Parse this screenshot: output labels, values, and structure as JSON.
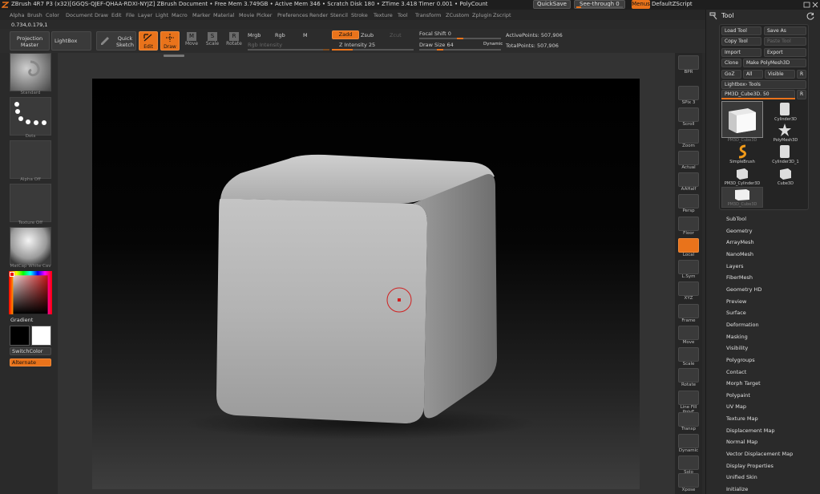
{
  "titlebar": {
    "title": "ZBrush 4R7 P3 (x32)[GGQS-QJEF-QHAA-RDXI-NYJZ]    ZBrush Document       • Free Mem 3.749GB • Active Mem 346 • Scratch Disk 180 •  ZTime 3.418  Timer 0.001 • PolyCount",
    "quicksave": "QuickSave",
    "see_through": "See-through  0",
    "see_through_value": 0,
    "menus": "Menus",
    "default_script": "DefaultZScript"
  },
  "menubar": {
    "items": [
      "Alpha",
      "Brush",
      "Color",
      "Document",
      "Draw",
      "Edit",
      "File",
      "Layer",
      "Light",
      "Macro",
      "Marker",
      "Material",
      "Movie",
      "Picker",
      "Preferences",
      "Render",
      "Stencil",
      "Stroke",
      "Texture",
      "Tool",
      "Transform",
      "ZCustom",
      "Zplugin",
      "Zscript"
    ]
  },
  "coords": "0.734,0.179,1",
  "toolbar": {
    "projection_master": "Projection Master",
    "lightbox": "LightBox",
    "quick_sketch": "Quick Sketch",
    "edit": "Edit",
    "draw": "Draw",
    "move": "Move",
    "scale": "Scale",
    "rotate": "Rotate",
    "mrgb": "Mrgb",
    "rgb": "Rgb",
    "m": "M",
    "rgb_intensity": "Rgb Intensity",
    "zadd": "Zadd",
    "zsub": "Zsub",
    "zcut": "Zcut",
    "z_intensity": "Z Intensity 25",
    "z_intensity_value": 25,
    "focal_shift": "Focal Shift 0",
    "draw_size": "Draw Size 64",
    "dynamic": "Dynamic",
    "active_points": "ActivePoints: 507,906",
    "total_points": "TotalPoints: 507,906"
  },
  "leftshelf": {
    "brush_caption": "Standard",
    "stroke_caption": "Dots",
    "alpha_caption": "Alpha Off",
    "texture_caption": "Texture Off",
    "material_caption": "MatCap White Cav",
    "gradient": "Gradient",
    "switch_color": "SwitchColor",
    "alternate": "Alternate"
  },
  "rightshelf": {
    "buttons": [
      "BPR",
      "SPix 3",
      "Scroll",
      "Zoom",
      "Actual",
      "AAHalf",
      "Persp",
      "Floor",
      "Local",
      "L.Sym",
      "XYZ",
      "Frame",
      "Move",
      "Scale",
      "Rotate",
      "Line Fill PolyF",
      "Transp",
      "Dynamic",
      "Solo",
      "Xpose"
    ]
  },
  "toolpanel": {
    "title": "Tool",
    "load_tool": "Load Tool",
    "save_as": "Save As",
    "copy_tool": "Copy Tool",
    "paste_tool": "Paste Tool",
    "import": "Import",
    "export": "Export",
    "clone": "Clone",
    "make_polymesh": "Make PolyMesh3D",
    "goz": "GoZ",
    "all": "All",
    "visible": "Visible",
    "r": "R",
    "lightbox_tools": "Lightbox› Tools",
    "current_tool": "PM3D_Cube3D. 50",
    "tools": [
      {
        "name": "PM3D_Cube3D",
        "icon": "cube-icon"
      },
      {
        "name": "Cylinder3D",
        "icon": "cylinder-icon"
      },
      {
        "name": "PolyMesh3D",
        "icon": "star-icon"
      },
      {
        "name": "SimpleBrush",
        "icon": "simplebrush-icon"
      },
      {
        "name": "Cylinder3D_1",
        "icon": "cylinder-icon"
      },
      {
        "name": "PM3D_Cylinder3D",
        "icon": "cube-icon"
      },
      {
        "name": "Cube3D",
        "icon": "cube-icon"
      },
      {
        "name": "PM3D_Cube3D",
        "icon": "cube-icon"
      }
    ],
    "subpalettes": [
      "SubTool",
      "Geometry",
      "ArrayMesh",
      "NanoMesh",
      "Layers",
      "FiberMesh",
      "Geometry HD",
      "Preview",
      "Surface",
      "Deformation",
      "Masking",
      "Visibility",
      "Polygroups",
      "Contact",
      "Morph Target",
      "Polypaint",
      "UV Map",
      "Texture Map",
      "Displacement Map",
      "Normal Map",
      "Vector Displacement Map",
      "Display Properties",
      "Unified Skin",
      "Initialize"
    ]
  },
  "colors": {
    "accent": "#e9731b",
    "background": "#2a2a2a",
    "cursor_ring": "#d02020"
  }
}
